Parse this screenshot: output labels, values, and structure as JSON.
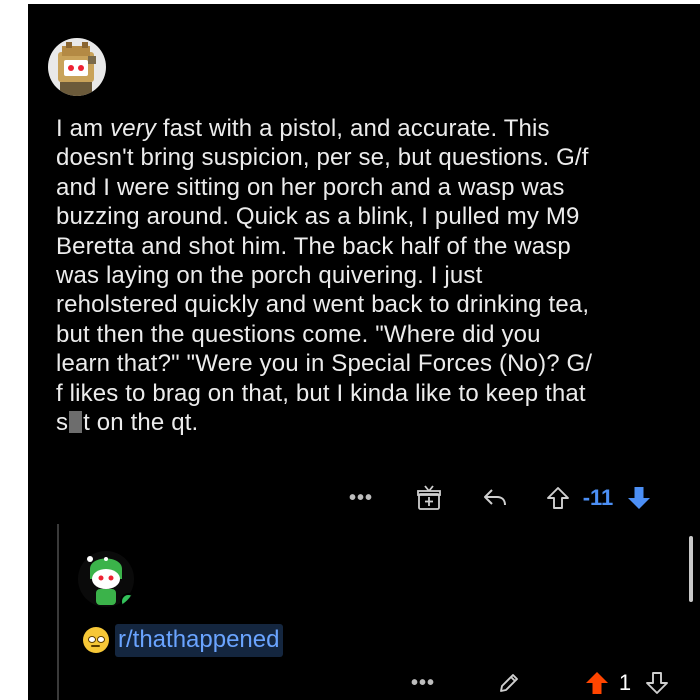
{
  "post": {
    "lines": [
      {
        "pre": "I am ",
        "em": "very",
        "post": " fast with a pistol, and accurate. This"
      },
      {
        "text": "doesn't bring suspicion, per se, but questions. G/f"
      },
      {
        "text": "and I were sitting on her porch and a wasp was"
      },
      {
        "text": "buzzing around. Quick as a blink, I pulled my M9"
      },
      {
        "text": "Beretta and shot him. The back half of the wasp"
      },
      {
        "text": "was laying on the porch quivering. I just"
      },
      {
        "text": "reholstered quickly and went back to drinking tea,"
      },
      {
        "text": "but then the questions come. \"Where did you"
      },
      {
        "text": "learn that?\" \"Were you in Special Forces (No)?  G/"
      },
      {
        "text": "f likes to brag on that, but I kinda like to keep that"
      },
      {
        "pre": "s",
        "post": "t on the qt."
      }
    ],
    "score": "-11",
    "vote_state": "downvoted"
  },
  "reply": {
    "text": "r/thathappened",
    "score": "1",
    "vote_state": "upvoted"
  },
  "icons": [
    "more-icon",
    "award-icon",
    "reply-icon",
    "upvote-icon",
    "downvote-icon",
    "edit-icon",
    "emoji-icon"
  ],
  "colors": {
    "background": "#000000",
    "text": "#ececec",
    "downvote": "#4c8ff5",
    "upvote": "#ff4500",
    "link": "#6aa4ff"
  }
}
